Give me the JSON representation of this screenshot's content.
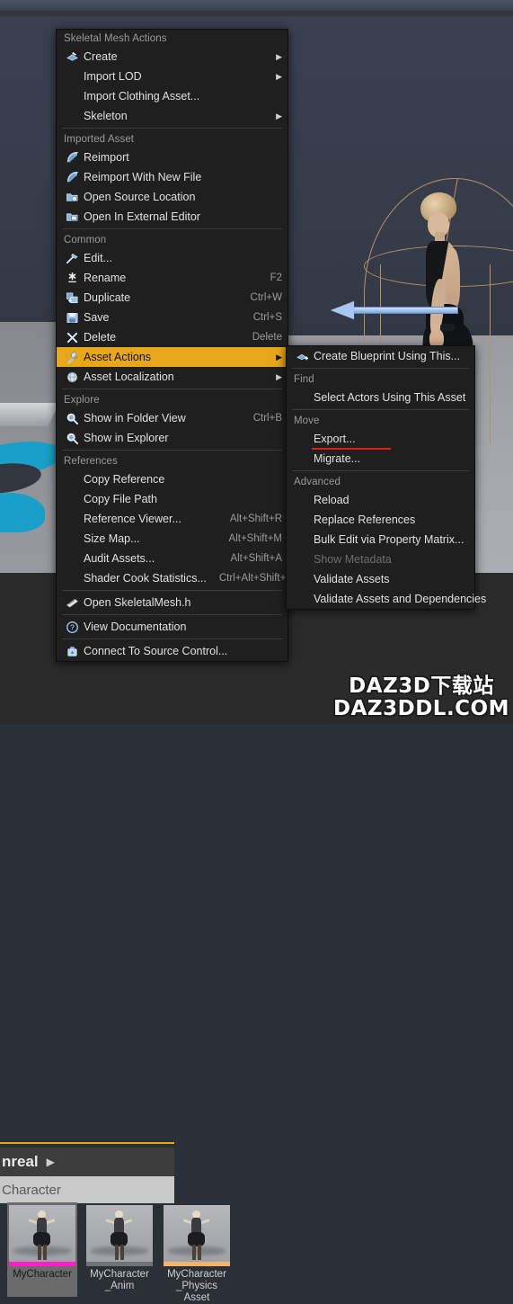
{
  "viewport": {
    "character_name": "MyCharacter"
  },
  "content_browser": {
    "breadcrumb_label": "nreal",
    "breadcrumb_arrow": "▶",
    "path_label": "Character",
    "assets": [
      {
        "label_line1": "MyCharacter",
        "label_line2": "",
        "label_line3": "",
        "bar_color": "#ff1fc8",
        "selected": true
      },
      {
        "label_line1": "MyCharacter",
        "label_line2": "_Anim",
        "label_line3": "",
        "bar_color": "#6f7378",
        "selected": false
      },
      {
        "label_line1": "MyCharacter",
        "label_line2": "_Physics",
        "label_line3": "Asset",
        "bar_color": "#f2b36a",
        "selected": false
      }
    ]
  },
  "context_menu": {
    "sections": [
      {
        "header": "Skeletal Mesh Actions",
        "items": [
          {
            "label": "Create",
            "icon": "create-mesh-icon",
            "shortcut": "",
            "submenu": true,
            "disabled": false
          },
          {
            "label": "Import LOD",
            "icon": "",
            "shortcut": "",
            "submenu": true,
            "disabled": false
          },
          {
            "label": "Import Clothing Asset...",
            "icon": "",
            "shortcut": "",
            "submenu": false,
            "disabled": false
          },
          {
            "label": "Skeleton",
            "icon": "",
            "shortcut": "",
            "submenu": true,
            "disabled": false
          }
        ]
      },
      {
        "header": "Imported Asset",
        "items": [
          {
            "label": "Reimport",
            "icon": "reimport-icon",
            "shortcut": "",
            "submenu": false,
            "disabled": false
          },
          {
            "label": "Reimport With New File",
            "icon": "reimport-icon",
            "shortcut": "",
            "submenu": false,
            "disabled": false
          },
          {
            "label": "Open Source Location",
            "icon": "folder-open-icon",
            "shortcut": "",
            "submenu": false,
            "disabled": false
          },
          {
            "label": "Open In External Editor",
            "icon": "external-editor-icon",
            "shortcut": "",
            "submenu": false,
            "disabled": false
          }
        ]
      },
      {
        "header": "Common",
        "items": [
          {
            "label": "Edit...",
            "icon": "edit-hammer-icon",
            "shortcut": "",
            "submenu": false,
            "disabled": false
          },
          {
            "label": "Rename",
            "icon": "rename-icon",
            "shortcut": "F2",
            "submenu": false,
            "disabled": false
          },
          {
            "label": "Duplicate",
            "icon": "duplicate-icon",
            "shortcut": "Ctrl+W",
            "submenu": false,
            "disabled": false
          },
          {
            "label": "Save",
            "icon": "save-floppy-icon",
            "shortcut": "Ctrl+S",
            "submenu": false,
            "disabled": false
          },
          {
            "label": "Delete",
            "icon": "delete-x-icon",
            "shortcut": "Delete",
            "submenu": false,
            "disabled": false
          },
          {
            "label": "Asset Actions",
            "icon": "wrench-icon",
            "shortcut": "",
            "submenu": true,
            "disabled": false,
            "highlighted": true
          },
          {
            "label": "Asset Localization",
            "icon": "globe-icon",
            "shortcut": "",
            "submenu": true,
            "disabled": false
          }
        ]
      },
      {
        "header": "Explore",
        "items": [
          {
            "label": "Show in Folder View",
            "icon": "magnifier-icon",
            "shortcut": "Ctrl+B",
            "submenu": false,
            "disabled": false
          },
          {
            "label": "Show in Explorer",
            "icon": "magnifier-icon",
            "shortcut": "",
            "submenu": false,
            "disabled": false
          }
        ]
      },
      {
        "header": "References",
        "items": [
          {
            "label": "Copy Reference",
            "icon": "",
            "shortcut": "",
            "submenu": false,
            "disabled": false
          },
          {
            "label": "Copy File Path",
            "icon": "",
            "shortcut": "",
            "submenu": false,
            "disabled": false
          },
          {
            "label": "Reference Viewer...",
            "icon": "",
            "shortcut": "Alt+Shift+R",
            "submenu": false,
            "disabled": false
          },
          {
            "label": "Size Map...",
            "icon": "",
            "shortcut": "Alt+Shift+M",
            "submenu": false,
            "disabled": false
          },
          {
            "label": "Audit Assets...",
            "icon": "",
            "shortcut": "Alt+Shift+A",
            "submenu": false,
            "disabled": false
          },
          {
            "label": "Shader Cook Statistics...",
            "icon": "",
            "shortcut": "Ctrl+Alt+Shift+S",
            "submenu": false,
            "disabled": false
          }
        ]
      },
      {
        "header": "",
        "items": [
          {
            "label": "Open SkeletalMesh.h",
            "icon": "cpp-header-icon",
            "shortcut": "",
            "submenu": false,
            "disabled": false
          }
        ]
      },
      {
        "header": "",
        "items": [
          {
            "label": "View Documentation",
            "icon": "help-circle-icon",
            "shortcut": "",
            "submenu": false,
            "disabled": false
          }
        ]
      },
      {
        "header": "",
        "items": [
          {
            "label": "Connect To Source Control...",
            "icon": "source-control-icon",
            "shortcut": "",
            "submenu": false,
            "disabled": false
          }
        ]
      }
    ]
  },
  "submenu": {
    "sections": [
      {
        "header": "",
        "items": [
          {
            "label": "Create Blueprint Using This...",
            "icon": "blueprint-icon",
            "shortcut": "",
            "disabled": false,
            "underlined": false
          }
        ]
      },
      {
        "header": "Find",
        "items": [
          {
            "label": "Select Actors Using This Asset",
            "icon": "",
            "shortcut": "",
            "disabled": false,
            "underlined": false
          }
        ]
      },
      {
        "header": "Move",
        "items": [
          {
            "label": "Export...",
            "icon": "",
            "shortcut": "",
            "disabled": false,
            "underlined": true
          },
          {
            "label": "Migrate...",
            "icon": "",
            "shortcut": "",
            "disabled": false,
            "underlined": false
          }
        ]
      },
      {
        "header": "Advanced",
        "items": [
          {
            "label": "Reload",
            "icon": "",
            "shortcut": "",
            "disabled": false,
            "underlined": false
          },
          {
            "label": "Replace References",
            "icon": "",
            "shortcut": "",
            "disabled": false,
            "underlined": false
          },
          {
            "label": "Bulk Edit via Property Matrix...",
            "icon": "",
            "shortcut": "",
            "disabled": false,
            "underlined": false
          },
          {
            "label": "Show Metadata",
            "icon": "",
            "shortcut": "",
            "disabled": true,
            "underlined": false
          },
          {
            "label": "Validate Assets",
            "icon": "",
            "shortcut": "",
            "disabled": false,
            "underlined": false
          },
          {
            "label": "Validate Assets and Dependencies",
            "icon": "",
            "shortcut": "",
            "disabled": false,
            "underlined": false
          }
        ]
      }
    ]
  },
  "watermark": {
    "line1": "DAZ3D下载站",
    "line2": "DAZ3DDL.COM"
  },
  "colors": {
    "highlight": "#e8a71b",
    "underline": "#e01d1d",
    "menu_bg": "#1f1f1f",
    "selected_asset_bar": "#ff1fc8"
  }
}
